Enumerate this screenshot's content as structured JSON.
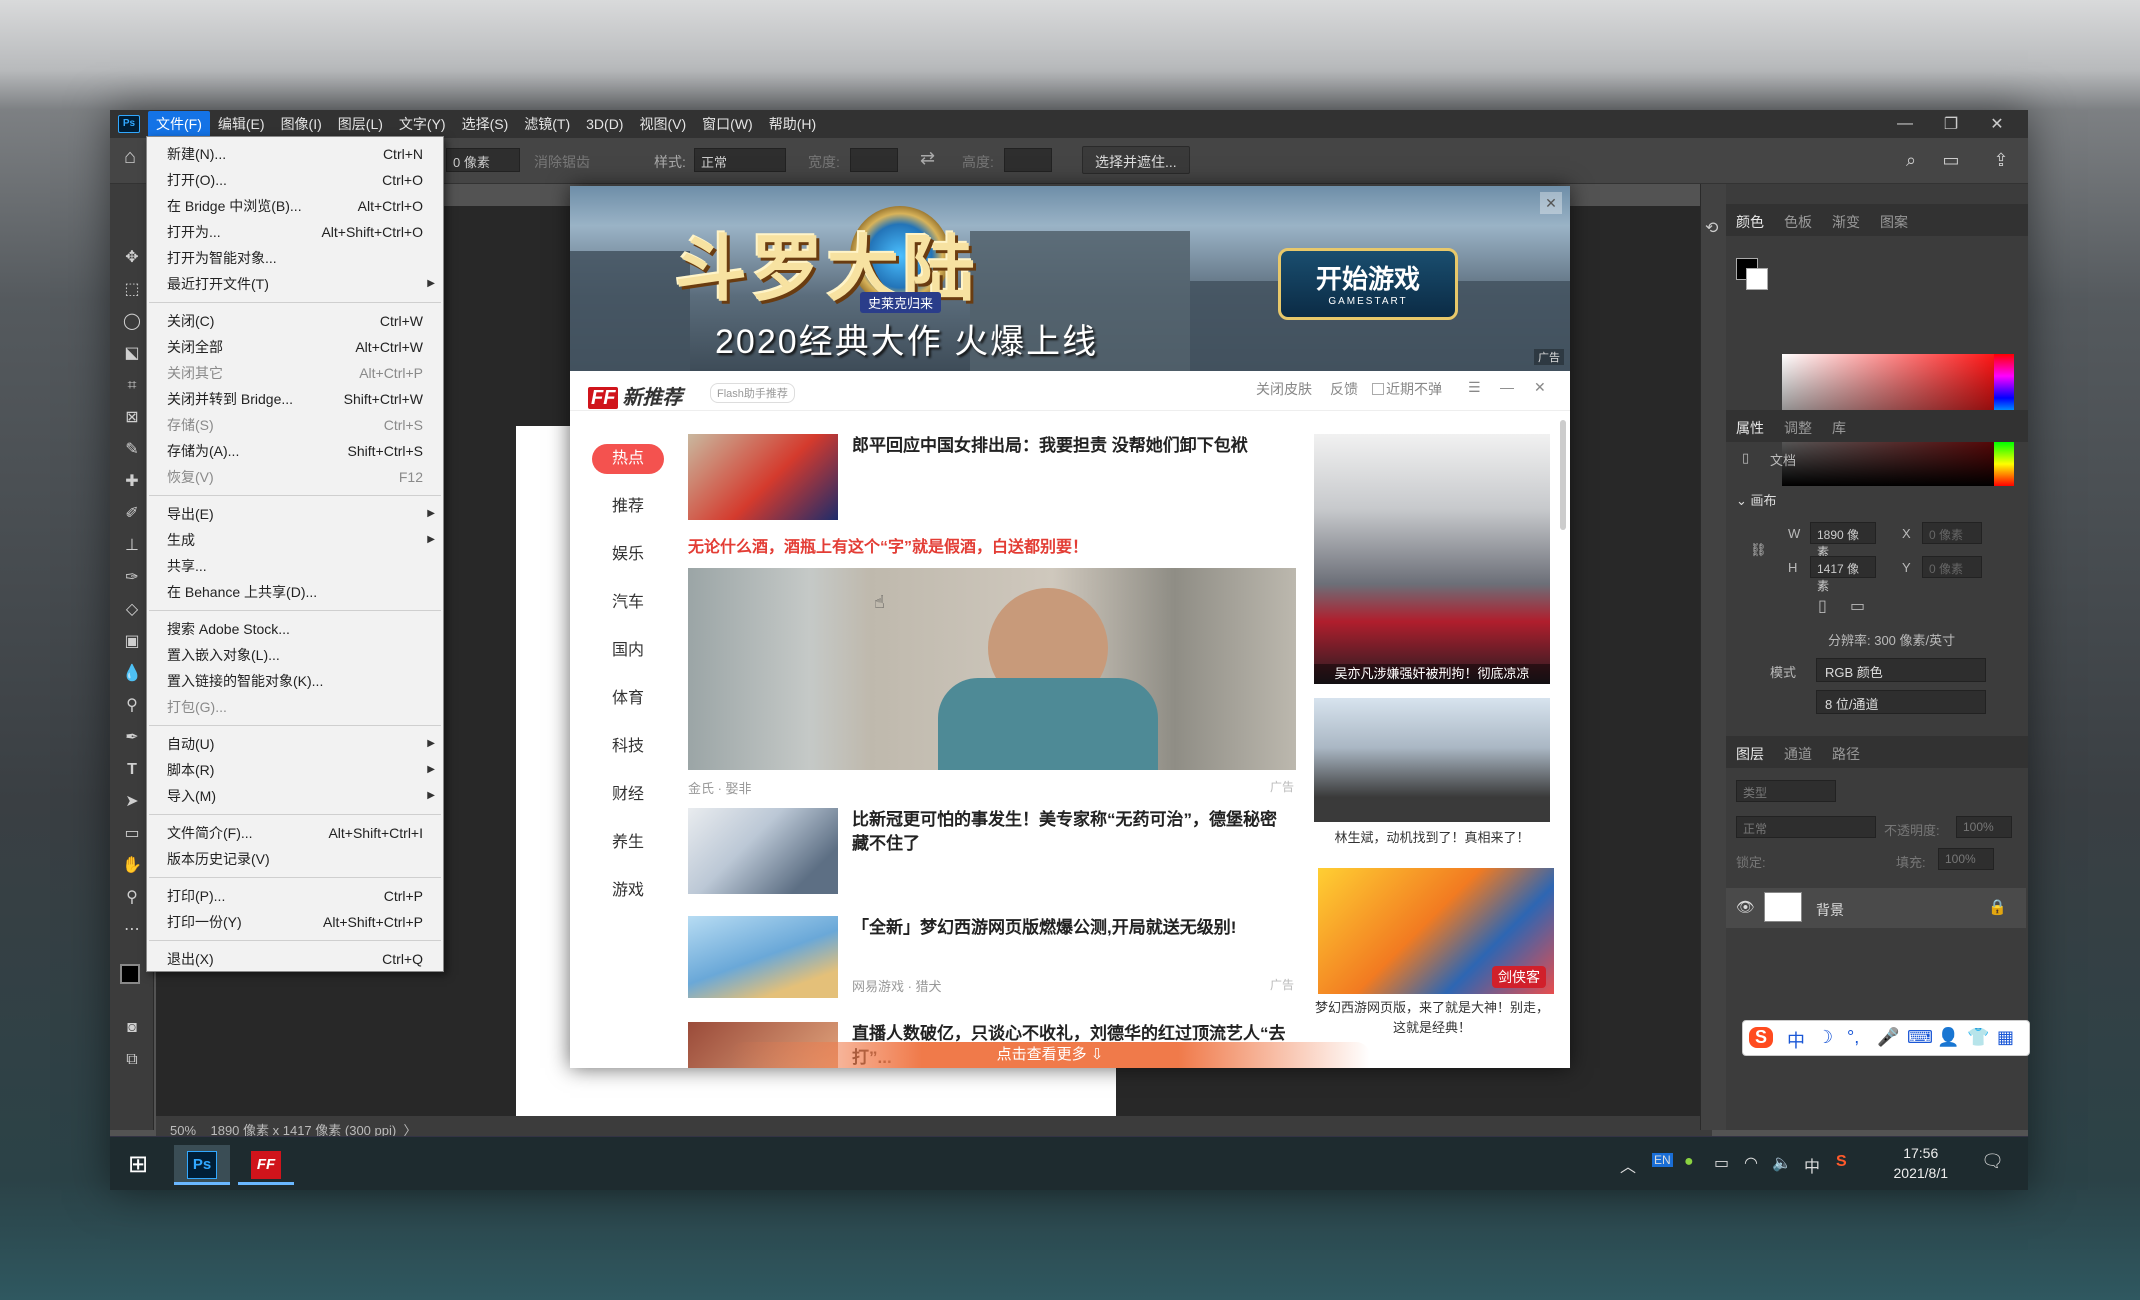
{
  "photoshop": {
    "logo": "Ps",
    "menus": [
      "文件(F)",
      "编辑(E)",
      "图像(I)",
      "图层(L)",
      "文字(Y)",
      "选择(S)",
      "滤镜(T)",
      "3D(D)",
      "视图(V)",
      "窗口(W)",
      "帮助(H)"
    ],
    "active_menu": "文件(F)",
    "window_controls": [
      "—",
      "❐",
      "✕"
    ],
    "options": {
      "feather_value": "0 像素",
      "antialias": "消除锯齿",
      "style_label": "样式:",
      "style_value": "正常",
      "width_label": "宽度:",
      "height_label": "高度:",
      "select_mask_button": "选择并遮住..."
    },
    "status": {
      "zoom": "50%",
      "doc_info": "1890 像素 x 1417 像素 (300 ppi)",
      "arrow": "〉"
    }
  },
  "file_menu": [
    {
      "label": "新建(N)...",
      "shortcut": "Ctrl+N"
    },
    {
      "label": "打开(O)...",
      "shortcut": "Ctrl+O"
    },
    {
      "label": "在 Bridge 中浏览(B)...",
      "shortcut": "Alt+Ctrl+O"
    },
    {
      "label": "打开为...",
      "shortcut": "Alt+Shift+Ctrl+O"
    },
    {
      "label": "打开为智能对象...",
      "shortcut": ""
    },
    {
      "label": "最近打开文件(T)",
      "shortcut": "",
      "submenu": true
    },
    {
      "label": "关闭(C)",
      "shortcut": "Ctrl+W"
    },
    {
      "label": "关闭全部",
      "shortcut": "Alt+Ctrl+W"
    },
    {
      "label": "关闭其它",
      "shortcut": "Alt+Ctrl+P",
      "disabled": true
    },
    {
      "label": "关闭并转到 Bridge...",
      "shortcut": "Shift+Ctrl+W"
    },
    {
      "label": "存储(S)",
      "shortcut": "Ctrl+S",
      "disabled": true
    },
    {
      "label": "存储为(A)...",
      "shortcut": "Shift+Ctrl+S"
    },
    {
      "label": "恢复(V)",
      "shortcut": "F12",
      "disabled": true
    },
    {
      "label": "导出(E)",
      "shortcut": "",
      "submenu": true
    },
    {
      "label": "生成",
      "shortcut": "",
      "submenu": true
    },
    {
      "label": "共享...",
      "shortcut": ""
    },
    {
      "label": "在 Behance 上共享(D)...",
      "shortcut": ""
    },
    {
      "label": "搜索 Adobe Stock...",
      "shortcut": ""
    },
    {
      "label": "置入嵌入对象(L)...",
      "shortcut": ""
    },
    {
      "label": "置入链接的智能对象(K)...",
      "shortcut": ""
    },
    {
      "label": "打包(G)...",
      "shortcut": "",
      "disabled": true
    },
    {
      "label": "自动(U)",
      "shortcut": "",
      "submenu": true
    },
    {
      "label": "脚本(R)",
      "shortcut": "",
      "submenu": true
    },
    {
      "label": "导入(M)",
      "shortcut": "",
      "submenu": true
    },
    {
      "label": "文件简介(F)...",
      "shortcut": "Alt+Shift+Ctrl+I"
    },
    {
      "label": "版本历史记录(V)",
      "shortcut": ""
    },
    {
      "label": "打印(P)...",
      "shortcut": "Ctrl+P"
    },
    {
      "label": "打印一份(Y)",
      "shortcut": "Alt+Shift+Ctrl+P"
    },
    {
      "label": "退出(X)",
      "shortcut": "Ctrl+Q"
    }
  ],
  "panels": {
    "color_tabs": [
      "颜色",
      "色板",
      "渐变",
      "图案"
    ],
    "props_tabs": [
      "属性",
      "调整",
      "库"
    ],
    "doc_label": "文档",
    "canvas_section": "画布",
    "w_label": "W",
    "w_value": "1890 像素",
    "h_label": "H",
    "h_value": "1417 像素",
    "x_label": "X",
    "y_label": "Y",
    "x_placeholder": "0 像素",
    "y_placeholder": "0 像素",
    "resolution": "分辨率: 300 像素/英寸",
    "mode_label": "模式",
    "mode_value": "RGB 颜色",
    "depth_value": "8 位/通道",
    "layer_tabs": [
      "图层",
      "通道",
      "路径"
    ],
    "layer_search": "类型",
    "blend_mode": "正常",
    "opacity_label": "不透明度:",
    "opacity_value": "100%",
    "lock_label": "锁定:",
    "fill_label": "填充:",
    "fill_value": "100%",
    "layer_name": "背景"
  },
  "popup": {
    "banner": {
      "title": "斗罗大陆",
      "emblem_sub": "史莱克归来",
      "slogan": "2020经典大作 火爆上线",
      "start_main": "开始游戏",
      "start_sub": "GAMESTART",
      "ad": "广告",
      "close": "✕"
    },
    "header": {
      "logo_mark": "FF",
      "logo_text": "新推荐",
      "tag": "Flash助手推荐",
      "skin": "关闭皮肤",
      "feedback": "反馈",
      "no_popup": "近期不弹",
      "menu": "☰",
      "minimize": "—",
      "close": "✕"
    },
    "nav": [
      "热点",
      "推荐",
      "娱乐",
      "汽车",
      "国内",
      "体育",
      "科技",
      "财经",
      "养生",
      "游戏"
    ],
    "news": [
      {
        "title": "郎平回应中国女排出局：我要担责 没帮她们卸下包袱"
      },
      {
        "title": "无论什么酒，酒瓶上有这个“字”就是假酒，白送都别要！",
        "source": "金氏 · 娶非",
        "ad": "广告"
      },
      {
        "title": "比新冠更可怕的事发生！美专家称“无药可治”，德堡秘密藏不住了"
      },
      {
        "title": "「全新」梦幻西游网页版燃爆公测,开局就送无级别!",
        "source": "网易游戏 · 猎犬",
        "ad": "广告"
      },
      {
        "title": "直播人数破亿，只谈心不收礼，刘德华的红过顶流艺人“去打”..."
      }
    ],
    "side": [
      {
        "caption": "吴亦凡涉嫌强奸被刑拘！彻底凉凉"
      },
      {
        "caption": "林生斌，动机找到了！真相来了！"
      },
      {
        "caption": "梦幻西游网页版，来了就是大神！别走，这就是经典！",
        "badge": "剑侠客"
      }
    ],
    "more": "点击查看更多 ⇩"
  },
  "ime": [
    "S",
    "中",
    "☽",
    "°,",
    "🎤",
    "⌨",
    "👤",
    "👕",
    "▦"
  ],
  "taskbar": {
    "start": "⊞",
    "apps": [
      "Ps",
      "FF"
    ],
    "tray": [
      "︿",
      "EN",
      "●",
      "▭",
      "◠",
      "🔈",
      "中",
      "S"
    ],
    "time": "17:56",
    "date": "2021/8/1",
    "notify": "🗨"
  }
}
